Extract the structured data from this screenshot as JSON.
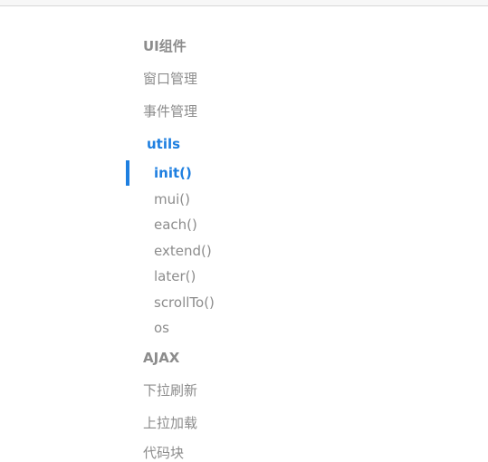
{
  "nav": {
    "items_before": [
      {
        "label": "UI组件",
        "bold": true
      },
      {
        "label": "窗口管理",
        "bold": false
      },
      {
        "label": "事件管理",
        "bold": false
      }
    ],
    "active_section": "utils",
    "sub_items": [
      {
        "label": "init()",
        "active": true
      },
      {
        "label": "mui()",
        "active": false
      },
      {
        "label": "each()",
        "active": false
      },
      {
        "label": "extend()",
        "active": false
      },
      {
        "label": "later()",
        "active": false
      },
      {
        "label": "scrollTo()",
        "active": false
      },
      {
        "label": "os",
        "active": false
      }
    ],
    "items_after": [
      {
        "label": "AJAX",
        "bold": true
      },
      {
        "label": "下拉刷新",
        "bold": false
      },
      {
        "label": "上拉加载",
        "bold": false
      },
      {
        "label": "代码块",
        "bold": false
      }
    ]
  },
  "colors": {
    "active": "#1e7fe0",
    "text": "#8c8c8c"
  }
}
